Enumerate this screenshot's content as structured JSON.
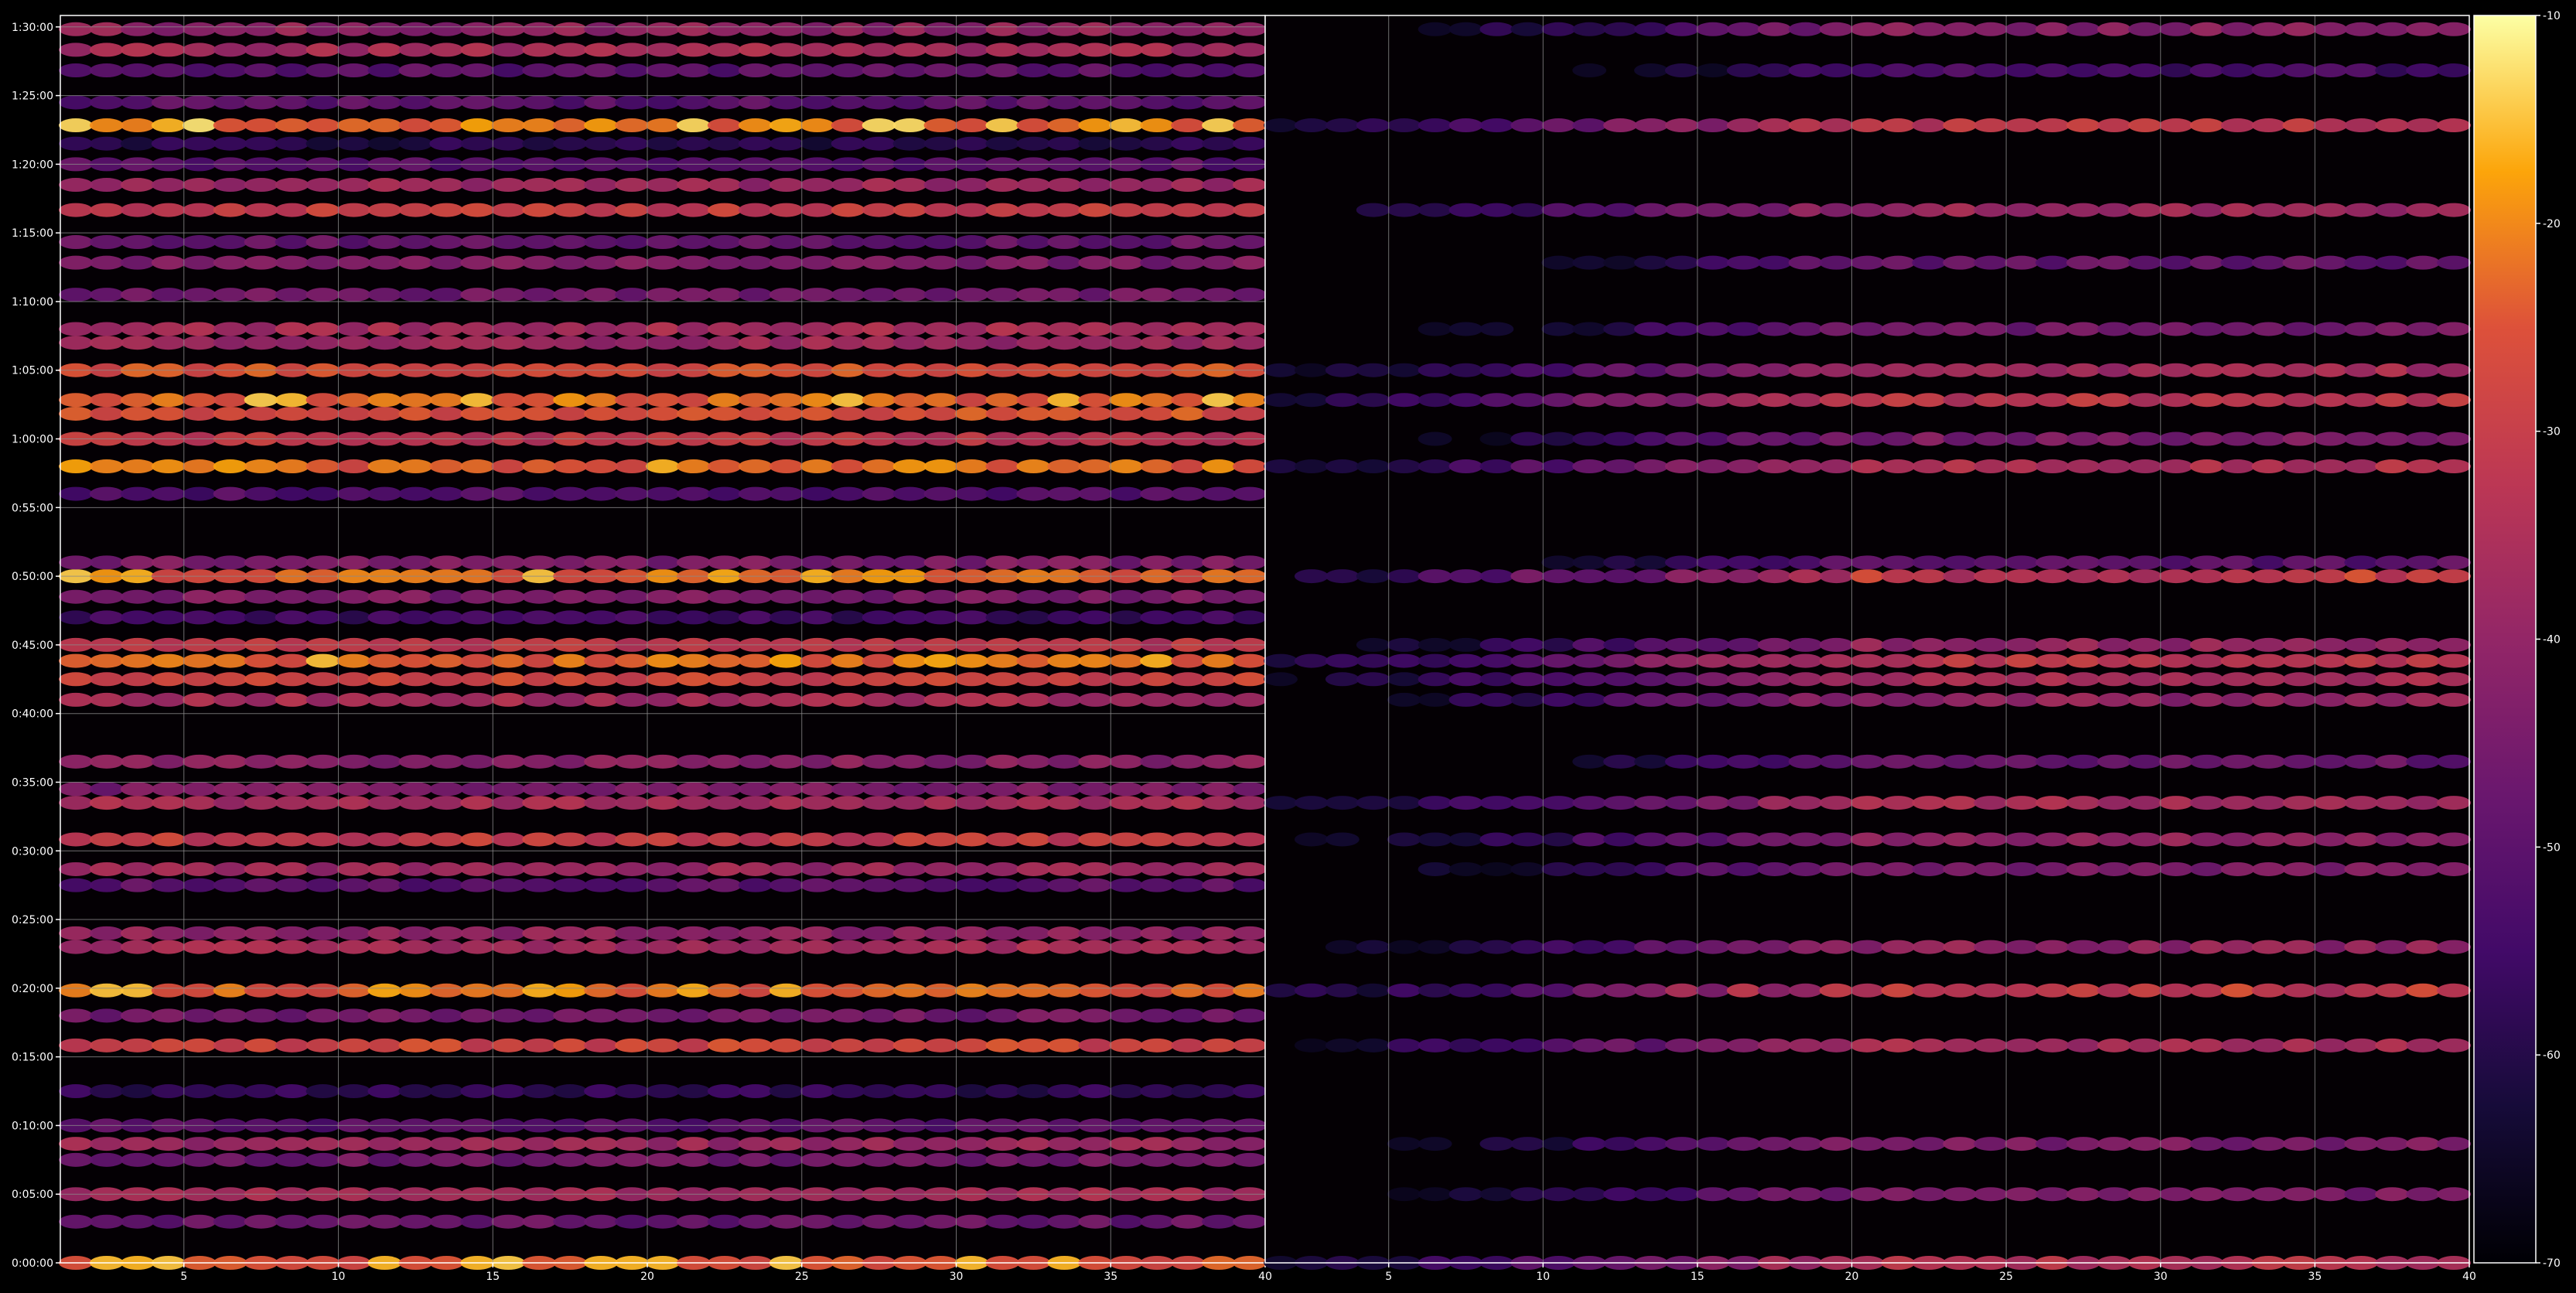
{
  "chart_data": [
    {
      "type": "heatmap",
      "panel": "left",
      "title": "",
      "xlabel": "",
      "ylabel": "",
      "x_ticks": [
        5,
        10,
        15,
        20,
        25,
        30,
        35,
        40
      ],
      "x_range": [
        1,
        40
      ],
      "y_ticks": [
        "0:00:00",
        "0:05:00",
        "0:10:00",
        "0:15:00",
        "0:20:00",
        "0:25:00",
        "0:30:00",
        "0:35:00",
        "0:40:00",
        "0:45:00",
        "0:50:00",
        "0:55:00",
        "1:00:00",
        "1:05:00",
        "1:10:00",
        "1:15:00",
        "1:20:00",
        "1:25:00",
        "1:30:00"
      ],
      "y_range_seconds": [
        0,
        5450
      ],
      "grid": true,
      "bands": [
        {
          "t": "0:00:00",
          "level": -24,
          "bright": true
        },
        {
          "t": "0:03:00",
          "level": -48
        },
        {
          "t": "0:05:00",
          "level": -36
        },
        {
          "t": "0:07:30",
          "level": -46
        },
        {
          "t": "0:08:40",
          "level": -38
        },
        {
          "t": "0:10:00",
          "level": -50
        },
        {
          "t": "0:12:30",
          "level": -58
        },
        {
          "t": "0:15:50",
          "level": -28
        },
        {
          "t": "0:18:00",
          "level": -46
        },
        {
          "t": "0:19:50",
          "level": -24,
          "bright": true
        },
        {
          "t": "0:23:00",
          "level": -36
        },
        {
          "t": "0:24:00",
          "level": -40
        },
        {
          "t": "0:27:30",
          "level": -50
        },
        {
          "t": "0:28:40",
          "level": -38
        },
        {
          "t": "0:30:50",
          "level": -30
        },
        {
          "t": "0:33:30",
          "level": -36
        },
        {
          "t": "0:34:30",
          "level": -44
        },
        {
          "t": "0:36:30",
          "level": -42
        },
        {
          "t": "0:41:00",
          "level": -36
        },
        {
          "t": "0:42:30",
          "level": -28
        },
        {
          "t": "0:43:50",
          "level": -24,
          "bright": true
        },
        {
          "t": "0:45:00",
          "level": -32
        },
        {
          "t": "0:47:00",
          "level": -56
        },
        {
          "t": "0:48:30",
          "level": -44
        },
        {
          "t": "0:50:00",
          "level": -24,
          "bright": true
        },
        {
          "t": "0:51:00",
          "level": -44
        },
        {
          "t": "0:56:00",
          "level": -52
        },
        {
          "t": "0:58:00",
          "level": -24,
          "bright": true
        },
        {
          "t": "1:00:00",
          "level": -32
        },
        {
          "t": "1:01:50",
          "level": -26
        },
        {
          "t": "1:02:50",
          "level": -24,
          "bright": true
        },
        {
          "t": "1:05:00",
          "level": -26
        },
        {
          "t": "1:07:00",
          "level": -38
        },
        {
          "t": "1:08:00",
          "level": -36
        },
        {
          "t": "1:10:30",
          "level": -46
        },
        {
          "t": "1:12:50",
          "level": -44
        },
        {
          "t": "1:14:20",
          "level": -48
        },
        {
          "t": "1:16:40",
          "level": -30
        },
        {
          "t": "1:18:30",
          "level": -38
        },
        {
          "t": "1:20:00",
          "level": -50
        },
        {
          "t": "1:21:30",
          "level": -60
        },
        {
          "t": "1:22:50",
          "level": -22,
          "bright": true
        },
        {
          "t": "1:24:30",
          "level": -50
        },
        {
          "t": "1:26:50",
          "level": -50
        },
        {
          "t": "1:28:20",
          "level": -36
        },
        {
          "t": "1:29:50",
          "level": -40
        }
      ]
    },
    {
      "type": "heatmap",
      "panel": "right",
      "title": "",
      "xlabel": "",
      "ylabel": "",
      "x_ticks": [
        5,
        10,
        15,
        20,
        25,
        30,
        35,
        40
      ],
      "x_range": [
        1,
        40
      ],
      "y_range_seconds": [
        0,
        5450
      ],
      "grid": true,
      "note_fade_in": "weak at low x, full strength from about x=20",
      "bands": [
        {
          "t": "0:00:00",
          "level": -34
        },
        {
          "t": "0:05:00",
          "level": -44
        },
        {
          "t": "0:08:40",
          "level": -44
        },
        {
          "t": "0:15:50",
          "level": -36
        },
        {
          "t": "0:19:50",
          "level": -34,
          "bright": true
        },
        {
          "t": "0:23:00",
          "level": -40
        },
        {
          "t": "0:28:40",
          "level": -44
        },
        {
          "t": "0:30:50",
          "level": -40
        },
        {
          "t": "0:33:30",
          "level": -36
        },
        {
          "t": "0:36:30",
          "level": -48
        },
        {
          "t": "0:41:00",
          "level": -40
        },
        {
          "t": "0:42:30",
          "level": -36
        },
        {
          "t": "0:43:50",
          "level": -32
        },
        {
          "t": "0:45:00",
          "level": -40
        },
        {
          "t": "0:50:00",
          "level": -34,
          "bright": true
        },
        {
          "t": "0:51:00",
          "level": -50
        },
        {
          "t": "0:58:00",
          "level": -34
        },
        {
          "t": "1:00:00",
          "level": -44
        },
        {
          "t": "1:02:50",
          "level": -32
        },
        {
          "t": "1:05:00",
          "level": -36
        },
        {
          "t": "1:08:00",
          "level": -46
        },
        {
          "t": "1:12:50",
          "level": -48
        },
        {
          "t": "1:16:40",
          "level": -38
        },
        {
          "t": "1:22:50",
          "level": -32
        },
        {
          "t": "1:26:50",
          "level": -54
        },
        {
          "t": "1:29:50",
          "level": -42
        }
      ]
    }
  ],
  "colorbar": {
    "colormap": "inferno",
    "range": [
      -70,
      -10
    ],
    "ticks": [
      "-10",
      "-20",
      "-30",
      "-40",
      "-50",
      "-60",
      "-70"
    ]
  },
  "colors": {
    "background": "#000000",
    "axes": "#ffffff",
    "grid": "#8a8a8a"
  }
}
